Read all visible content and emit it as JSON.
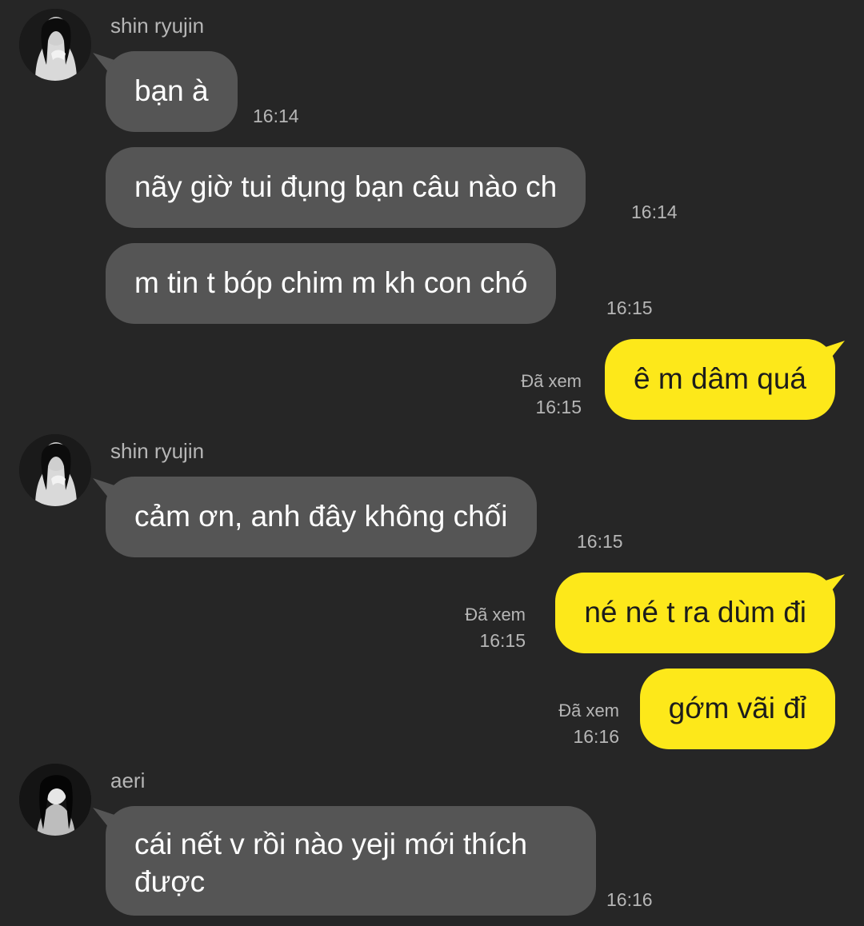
{
  "colors": {
    "background": "#262626",
    "incoming_bubble": "#555555",
    "outgoing_bubble": "#fde81a",
    "meta_text": "#b6b6b6"
  },
  "groups": [
    {
      "sender": "shin ryujin",
      "avatar_icon": "profile-photo-icon",
      "messages": [
        {
          "text": "bạn à",
          "time": "16:14"
        },
        {
          "text": "nãy giờ tui đụng bạn câu nào ch",
          "time": "16:14"
        },
        {
          "text": "m tin t bóp chim m kh con chó",
          "time": "16:15"
        }
      ]
    },
    {
      "sender": "shin ryujin",
      "avatar_icon": "profile-photo-icon",
      "messages": [
        {
          "text": "cảm ơn, anh đây không chối",
          "time": "16:15"
        }
      ]
    },
    {
      "sender": "aeri",
      "avatar_icon": "profile-photo-icon",
      "messages": [
        {
          "text": "cái nết v rồi nào yeji mới thích được",
          "time": "16:16"
        }
      ]
    }
  ],
  "outgoing": [
    {
      "text": "ê m dâm quá",
      "status": "Đã xem",
      "time": "16:15"
    },
    {
      "text": "né né t ra dùm đi",
      "status": "Đã xem",
      "time": "16:15"
    },
    {
      "text": "gớm vãi đỉ",
      "status": "Đã xem",
      "time": "16:16"
    }
  ]
}
